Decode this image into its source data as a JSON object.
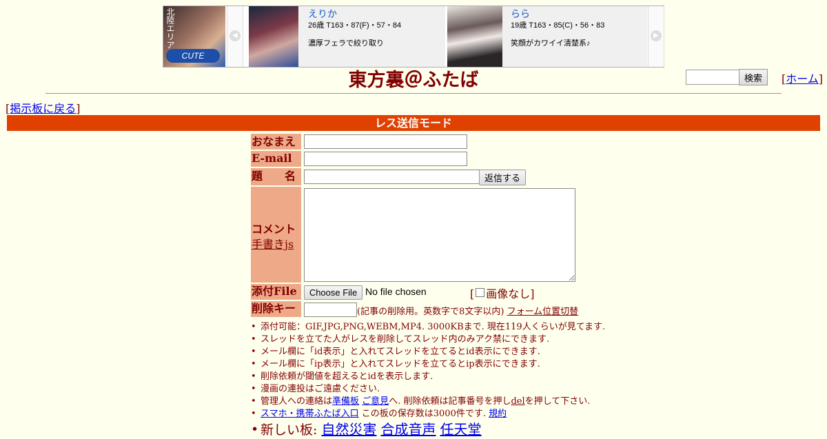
{
  "ad": {
    "logo_text": "CUTE",
    "logo_mark": "北陸エリア",
    "card1": {
      "name": "えりか",
      "stats": "26歳 T163・87(F)・57・84",
      "desc": "濃厚フェラで絞り取り"
    },
    "card2": {
      "name": "らら",
      "stats": "19歳 T163・85(C)・56・83",
      "desc": "笑顔がカワイイ清楚系♪"
    },
    "prev_arrow": "◀",
    "next_arrow": "▶"
  },
  "header": {
    "title": "東方裏＠ふたば",
    "search_button": "検索",
    "home_open": "[",
    "home_link": "ホーム",
    "home_close": "]"
  },
  "nav": {
    "back_open": "[",
    "back_link": "掲示板に戻る",
    "back_close": "]"
  },
  "mode_label": "レス送信モード",
  "form": {
    "name_label": "おなまえ",
    "email_label": "E-mail",
    "subject_label": "題　　名",
    "submit_button": "返信する",
    "comment_label": "コメント",
    "handwrite_link": "手書きjs",
    "file_label": "添付File",
    "choose_file_button": "Choose File",
    "file_status": "No file chosen",
    "no_image_open": "[",
    "no_image_label": "画像なし]",
    "delete_key_label": "削除キー",
    "delete_key_note": "(記事の削除用。英数字で8文字以内)",
    "form_position_link": "フォーム位置切替"
  },
  "notes": {
    "n1": "添付可能：GIF,JPG,PNG,WEBM,MP4. 3000KBまで. 現在119人くらいが見てます.",
    "n2": "スレッドを立てた人がレスを削除してスレッド内のみアク禁にできます.",
    "n3": "メール欄に「id表示」と入れてスレッドを立てるとid表示にできます.",
    "n4": "メール欄に「ip表示」と入れてスレッドを立てるとip表示にできます.",
    "n5": "削除依頼が閾値を超えるとidを表示します.",
    "n6": "漫画の連投はご遠慮ください.",
    "n7_pre": "管理人への連絡は",
    "n7_link1": "準備板",
    "n7_link2": "ご意見",
    "n7_mid": "へ. 削除依頼は記事番号を押し",
    "n7_link3": "del",
    "n7_post": "を押して下さい.",
    "n8_link1": "スマホ・携帯ふたば入口",
    "n8_mid": "この板の保存数は3000件です.",
    "n8_link2": "規約",
    "n9_pre": "新しい板:",
    "n9_link1": "自然災害",
    "n9_link2": "合成音声",
    "n9_link3": "任天堂"
  }
}
